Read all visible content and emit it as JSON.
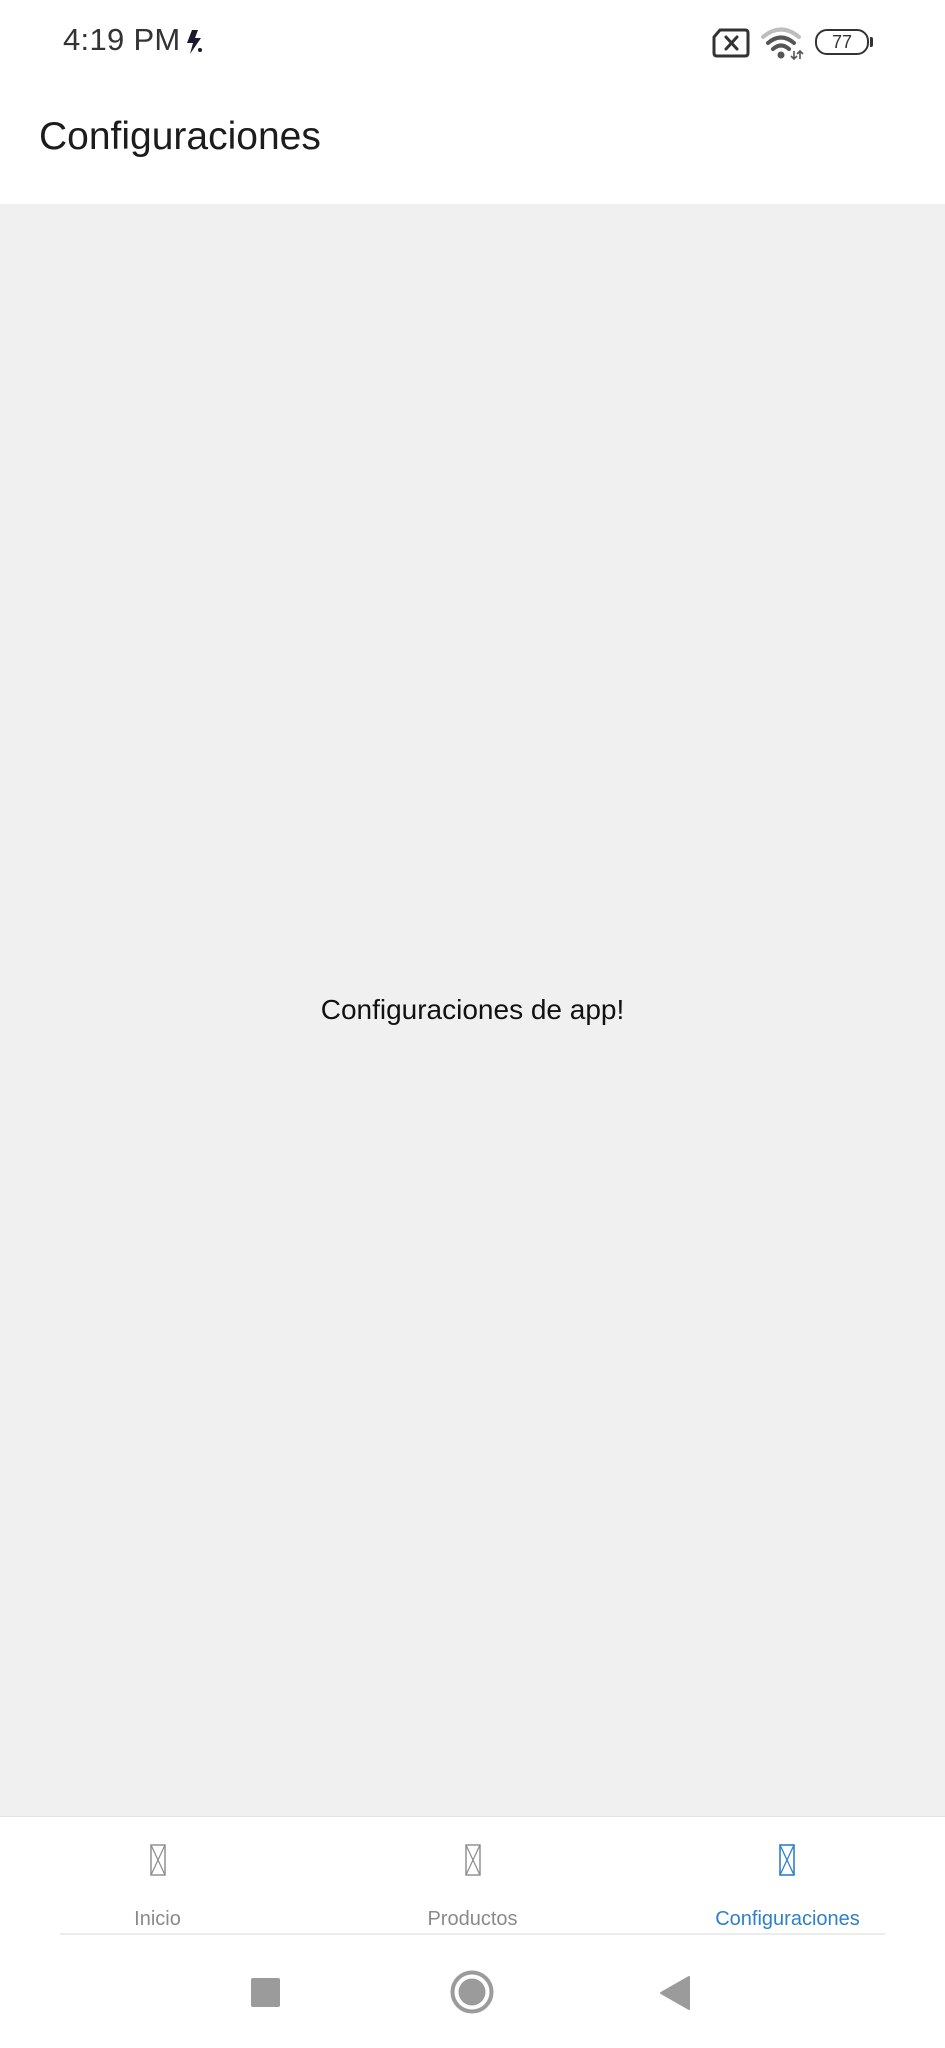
{
  "status_bar": {
    "time": "4:19 PM",
    "battery_level": "77",
    "icons": [
      "notification-bolt-icon",
      "no-sim-icon",
      "wifi-icon",
      "battery-icon"
    ]
  },
  "header": {
    "title": "Configuraciones"
  },
  "main": {
    "message": "Configuraciones de app!"
  },
  "tabs": [
    {
      "label": "Inicio",
      "icon": "placeholder-glyph-icon",
      "active": false
    },
    {
      "label": "Productos",
      "icon": "placeholder-glyph-icon",
      "active": false
    },
    {
      "label": "Configuraciones",
      "icon": "placeholder-glyph-icon",
      "active": true
    }
  ],
  "nav_bar": {
    "icons": [
      "recents-square-icon",
      "home-circle-icon",
      "back-triangle-icon"
    ]
  },
  "colors": {
    "accent": "#2f80c9",
    "inactive_tab": "#8a8a8a",
    "content_background": "#f0f0f0",
    "surface": "#ffffff"
  }
}
